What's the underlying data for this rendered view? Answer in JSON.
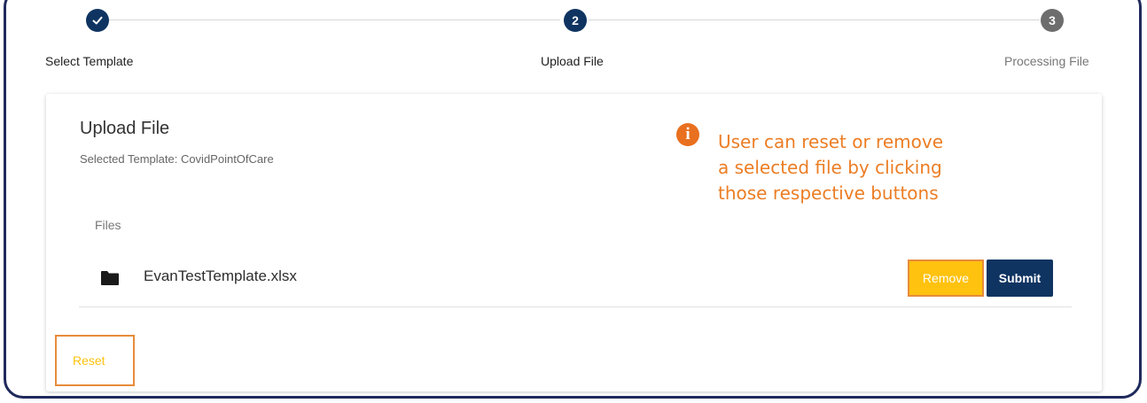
{
  "stepper": {
    "steps": [
      {
        "number": "",
        "label": "Select Template",
        "status": "completed",
        "icon": "check-icon"
      },
      {
        "number": "2",
        "label": "Upload File",
        "status": "active"
      },
      {
        "number": "3",
        "label": "Processing File",
        "status": "pending"
      }
    ]
  },
  "card": {
    "title": "Upload File",
    "subtitle": "Selected Template: CovidPointOfCare",
    "files_label": "Files",
    "file": {
      "name": "EvanTestTemplate.xlsx",
      "icon": "folder-icon"
    },
    "remove_label": "Remove",
    "submit_label": "Submit",
    "reset_label": "Reset"
  },
  "annotation": {
    "icon": "info-icon",
    "icon_glyph": "i",
    "lines": [
      "User can reset or remove",
      "a selected file by clicking",
      "those respective buttons"
    ]
  },
  "colors": {
    "primary": "#0f3461",
    "accent": "#ffc20e",
    "annotation": "#ec7d24",
    "pending": "#6d6d6d",
    "frame": "#1f2a5c"
  }
}
